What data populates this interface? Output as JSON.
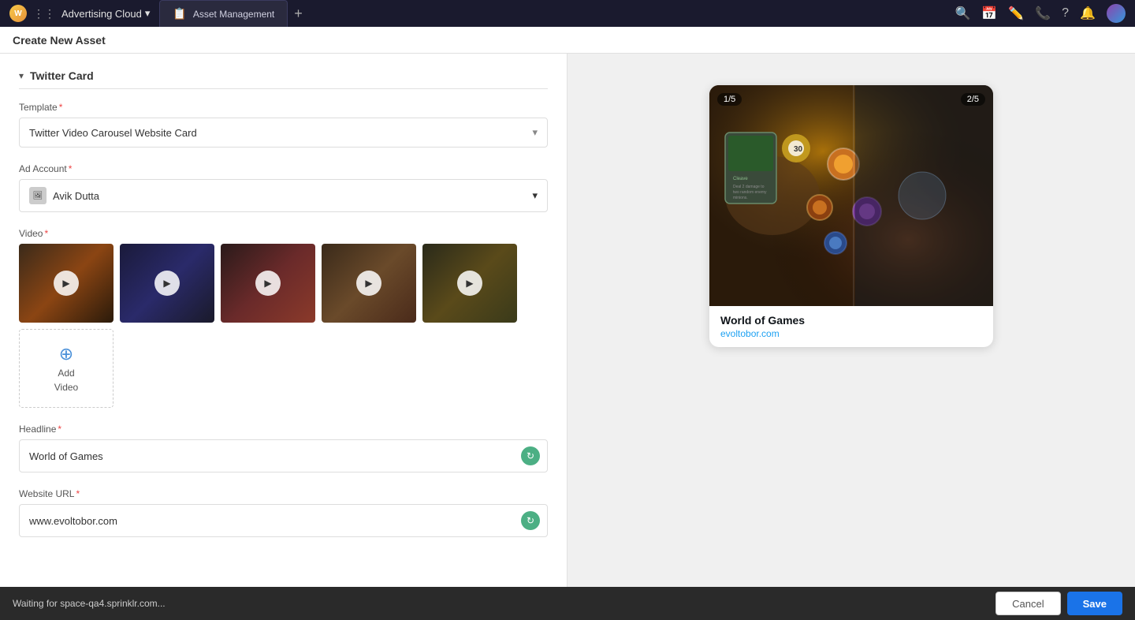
{
  "topbar": {
    "logo_text": "W",
    "app_name": "Advertising Cloud",
    "tab_label": "Asset Management",
    "tab_icon": "📋"
  },
  "page": {
    "title": "Create New Asset"
  },
  "form": {
    "section_title": "Twitter Card",
    "template_label": "Template",
    "template_value": "Twitter Video Carousel Website Card",
    "ad_account_label": "Ad Account",
    "ad_account_value": "Avik Dutta",
    "video_label": "Video",
    "add_video_label": "Add\nVideo",
    "headline_label": "Headline",
    "headline_value": "World of Games",
    "website_url_label": "Website URL",
    "website_url_value": "www.evoltobor.com"
  },
  "preview": {
    "counter_left": "1/5",
    "counter_right": "2/5",
    "card_title": "World of Games",
    "card_url": "evoltobor.com"
  },
  "buttons": {
    "cancel": "Cancel",
    "save": "Save"
  },
  "status": {
    "text": "Waiting for space-qa4.sprinklr.com..."
  },
  "icons": {
    "chevron_down": "▾",
    "play": "▶",
    "plus_circle": "⊕",
    "collapse": "▾",
    "refresh": "↻",
    "search": "🔍",
    "calendar": "📅",
    "pencil": "✏️",
    "phone": "📞",
    "question": "?",
    "bell": "🔔",
    "grid": "⋮⋮"
  }
}
